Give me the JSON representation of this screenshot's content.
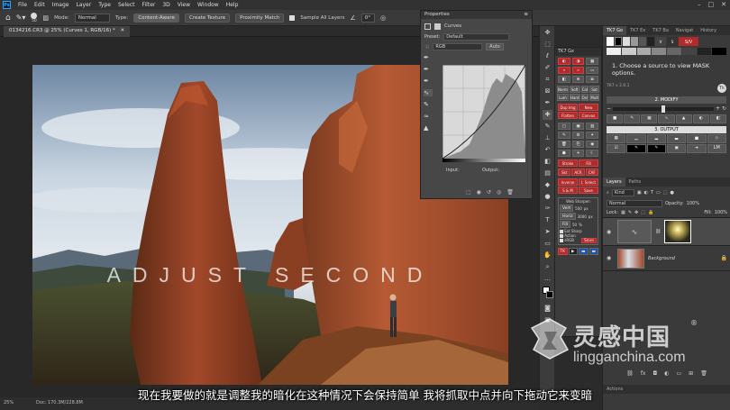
{
  "menubar": {
    "logo": "Ps",
    "items": [
      "File",
      "Edit",
      "Image",
      "Layer",
      "Type",
      "Select",
      "Filter",
      "3D",
      "View",
      "Window",
      "Help"
    ]
  },
  "options": {
    "mode_label": "Mode:",
    "mode_value": "Normal",
    "type_label": "Type:",
    "content_aware": "Content-Aware",
    "create_texture": "Create Texture",
    "proximity_match": "Proximity Match",
    "sample_all_layers": "Sample All Layers",
    "angle_value": "0°",
    "brush_size": "50"
  },
  "document": {
    "tab_title": "0134216.CR3 @ 25% (Curves 1, RGB/16) *",
    "overlay_title": "ADJUST SECOND",
    "zoom": "25%",
    "doc_size": "Doc: 170.3M/228.8M"
  },
  "properties": {
    "title": "Properties",
    "panel_name": "Curves",
    "preset_label": "Preset:",
    "preset_value": "Default",
    "channel_value": "RGB",
    "auto_label": "Auto",
    "input_label": "Input:",
    "output_label": "Output:"
  },
  "tk7_narrow": {
    "title": "TK7 Gx",
    "buttons": [
      "Norm",
      "Soft",
      "Col",
      "Sat",
      "Lum",
      "Hard",
      "Ovl",
      "Mult",
      "Dup Img",
      "New",
      "Flatten",
      "Canvas",
      "Stroke",
      "Fill",
      "Skt",
      "ACR",
      "CAF",
      "Inverse",
      "I. Select",
      "S & M",
      "Save",
      "Web Sharpen",
      "Ext Sharp",
      "Action",
      "sRGB",
      "Save"
    ],
    "web_sharpen": {
      "w_label": "Vert",
      "w_value": "500",
      "w_unit": "px",
      "h_label": "Horiz",
      "h_value": "3000",
      "h_unit": "px",
      "f_label": "Fill",
      "f_value": "50",
      "f_unit": "%"
    }
  },
  "tk7_main": {
    "tabs": [
      "TK7 Go",
      "TK7 Ex",
      "TK7 Ba",
      "Navigat",
      "History"
    ],
    "sv_label": "S/V",
    "instruction": "1.  Choose a source to view MASK options.",
    "version": "TK7 v 2.0.1",
    "modify_label": "2. MODIFY",
    "output_label": "3. OUTPUT",
    "lm_label": "LM"
  },
  "layers": {
    "tabs": [
      "Layers",
      "Paths"
    ],
    "kind_label": "Kind",
    "blend_mode": "Normal",
    "opacity_label": "Opacity:",
    "opacity_value": "100%",
    "lock_label": "Lock:",
    "fill_label": "Fill:",
    "fill_value": "100%",
    "items": [
      {
        "name": "",
        "type": "curves-adjustment"
      },
      {
        "name": "Background",
        "type": "image"
      }
    ],
    "bottom_tab": "Actions"
  },
  "subtitle": "现在我要做的就是调整我的暗化在这种情况下会保持简单 我将抓取中点并向下拖动它来变暗",
  "watermark": {
    "cn_text": "灵感中国",
    "url": "lingganchina.com",
    "registered": "®"
  },
  "colors": {
    "ps_blue": "#31a8ff",
    "tk_red": "#b22a2a",
    "panel_bg": "#3a3a3a",
    "menubar_bg": "#323232"
  }
}
